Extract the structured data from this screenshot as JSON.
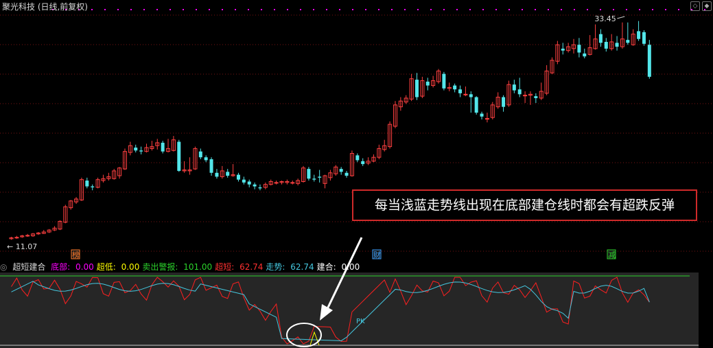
{
  "window": {
    "title": "聚光科技 (日线,前复权)"
  },
  "colors": {
    "up": "#ff4040",
    "down": "#53e6ea",
    "grid": "#7a1515",
    "magenta": "#ff00ff",
    "green_line": "#2bd22b",
    "red_line": "#ff2020",
    "cyan_line": "#45c8e0",
    "white": "#ffffff"
  },
  "price_chart": {
    "high_label": "33.45",
    "low_label": "11.07",
    "event_markers": [
      {
        "label": "榜",
        "color": "#ff7a2a"
      },
      {
        "label": "财",
        "color": "#3aa0ff"
      },
      {
        "label": "减",
        "color": "#2bd22b"
      }
    ]
  },
  "annotation": {
    "text": "每当浅蓝走势线出现在底部建仓线时都会有超跌反弹",
    "highlight_color": "#d02a2a"
  },
  "indicator": {
    "name": "超短建合",
    "items": [
      {
        "label": "底部:",
        "value": "0.00",
        "color": "#ff00ff"
      },
      {
        "label": "超低:",
        "value": "0.00",
        "color": "#ffff00"
      },
      {
        "label": "卖出警报:",
        "value": "101.00",
        "color": "#2bd22b"
      },
      {
        "label": "超短:",
        "value": "62.74",
        "color": "#ff3030"
      },
      {
        "label": "走势:",
        "value": "62.74",
        "color": "#45c8e0"
      },
      {
        "label": "建合:",
        "value": "0.00",
        "color": "#ffffff"
      }
    ],
    "pk_label": "PK"
  },
  "chart_data": {
    "type": "candlestick",
    "title": "聚光科技 (日线,前复权)",
    "ylim": [
      11.07,
      33.45
    ],
    "candles": [
      [
        11.0,
        11.1,
        10.9,
        11.2
      ],
      [
        11.1,
        11.15,
        11.0,
        11.3
      ],
      [
        11.2,
        11.3,
        11.1,
        11.4
      ],
      [
        11.3,
        11.35,
        11.2,
        11.5
      ],
      [
        11.3,
        11.5,
        11.2,
        11.6
      ],
      [
        11.5,
        11.6,
        11.4,
        11.7
      ],
      [
        11.55,
        11.7,
        11.5,
        11.9
      ],
      [
        11.7,
        11.9,
        11.6,
        12.0
      ],
      [
        11.9,
        12.1,
        11.8,
        12.3
      ],
      [
        12.0,
        12.8,
        11.9,
        12.9
      ],
      [
        12.7,
        14.3,
        12.6,
        14.5
      ],
      [
        14.2,
        14.9,
        14.0,
        15.0
      ],
      [
        14.8,
        15.1,
        14.6,
        15.3
      ],
      [
        15.0,
        17.1,
        14.9,
        17.3
      ],
      [
        17.0,
        16.4,
        16.2,
        17.3
      ],
      [
        16.4,
        16.3,
        16.0,
        16.6
      ],
      [
        16.3,
        17.1,
        16.2,
        17.3
      ],
      [
        17.0,
        17.2,
        16.8,
        17.6
      ],
      [
        17.2,
        17.4,
        17.0,
        17.8
      ],
      [
        17.2,
        18.0,
        17.1,
        18.2
      ],
      [
        17.5,
        18.3,
        17.2,
        18.4
      ],
      [
        18.2,
        20.0,
        18.1,
        20.3
      ],
      [
        19.9,
        20.6,
        19.6,
        21.0
      ],
      [
        20.4,
        20.1,
        19.9,
        20.7
      ],
      [
        20.1,
        20.0,
        19.7,
        20.5
      ],
      [
        20.0,
        20.4,
        19.9,
        20.8
      ],
      [
        20.3,
        20.5,
        20.1,
        21.1
      ],
      [
        20.6,
        20.9,
        20.2,
        21.3
      ],
      [
        20.9,
        20.0,
        19.8,
        21.1
      ],
      [
        20.0,
        20.3,
        19.9,
        21.3
      ],
      [
        20.1,
        21.2,
        20.0,
        21.6
      ],
      [
        21.0,
        18.0,
        17.9,
        21.2
      ],
      [
        18.0,
        18.1,
        17.8,
        19.0
      ],
      [
        18.0,
        18.1,
        17.6,
        19.4
      ],
      [
        18.2,
        20.3,
        18.1,
        20.5
      ],
      [
        20.0,
        19.4,
        19.2,
        20.3
      ],
      [
        19.4,
        19.1,
        18.9,
        19.6
      ],
      [
        19.2,
        17.8,
        17.5,
        19.4
      ],
      [
        17.8,
        17.4,
        17.2,
        18.2
      ],
      [
        17.4,
        18.0,
        17.2,
        18.5
      ],
      [
        17.9,
        17.5,
        17.3,
        18.2
      ],
      [
        17.5,
        17.6,
        17.4,
        18.7
      ],
      [
        17.6,
        17.1,
        16.9,
        17.8
      ],
      [
        17.1,
        16.8,
        16.6,
        17.4
      ],
      [
        16.9,
        16.6,
        16.3,
        17.1
      ],
      [
        16.6,
        16.4,
        16.1,
        16.8
      ],
      [
        16.3,
        16.2,
        16.0,
        16.6
      ],
      [
        16.3,
        16.6,
        16.1,
        16.8
      ],
      [
        16.6,
        16.9,
        16.5,
        17.1
      ],
      [
        16.8,
        16.8,
        16.6,
        17.0
      ],
      [
        16.8,
        16.9,
        16.6,
        17.0
      ],
      [
        16.8,
        16.9,
        16.6,
        17.1
      ],
      [
        16.8,
        16.8,
        16.6,
        17.0
      ],
      [
        16.7,
        17.0,
        16.5,
        17.2
      ],
      [
        16.9,
        18.3,
        16.8,
        18.5
      ],
      [
        18.2,
        17.2,
        17.0,
        18.4
      ],
      [
        17.2,
        17.1,
        16.9,
        17.6
      ],
      [
        17.4,
        17.3,
        16.8,
        18.1
      ],
      [
        16.7,
        17.5,
        16.2,
        17.6
      ],
      [
        17.3,
        17.8,
        17.0,
        18.1
      ],
      [
        17.7,
        18.4,
        17.5,
        18.6
      ],
      [
        18.2,
        17.9,
        17.6,
        18.4
      ],
      [
        17.8,
        17.5,
        17.3,
        18.0
      ],
      [
        17.5,
        19.8,
        17.4,
        20.1
      ],
      [
        19.6,
        19.1,
        18.9,
        19.8
      ],
      [
        19.0,
        18.7,
        18.5,
        19.3
      ],
      [
        18.8,
        19.0,
        18.6,
        19.4
      ],
      [
        19.0,
        19.4,
        18.9,
        19.7
      ],
      [
        19.4,
        20.3,
        19.2,
        20.7
      ],
      [
        20.2,
        20.6,
        20.0,
        21.2
      ],
      [
        20.5,
        22.8,
        20.3,
        23.1
      ],
      [
        22.6,
        24.8,
        22.4,
        25.2
      ],
      [
        24.6,
        25.2,
        24.2,
        25.6
      ],
      [
        25.1,
        25.5,
        24.9,
        25.8
      ],
      [
        25.4,
        27.5,
        25.2,
        28.0
      ],
      [
        27.4,
        25.6,
        25.3,
        28.1
      ],
      [
        25.7,
        27.3,
        25.5,
        27.7
      ],
      [
        27.2,
        26.8,
        26.3,
        27.6
      ],
      [
        26.8,
        27.3,
        26.6,
        27.8
      ],
      [
        27.2,
        28.3,
        27.0,
        28.5
      ],
      [
        28.0,
        26.5,
        26.3,
        28.2
      ],
      [
        26.5,
        26.6,
        26.2,
        27.1
      ],
      [
        26.8,
        26.4,
        26.1,
        27.0
      ],
      [
        26.4,
        26.0,
        25.6,
        26.8
      ],
      [
        25.9,
        25.9,
        25.7,
        26.7
      ],
      [
        25.9,
        25.6,
        24.0,
        26.2
      ],
      [
        25.6,
        24.0,
        23.8,
        25.7
      ],
      [
        23.9,
        23.6,
        23.3,
        24.1
      ],
      [
        23.4,
        23.4,
        23.0,
        24.0
      ],
      [
        23.5,
        24.8,
        23.3,
        25.1
      ],
      [
        24.6,
        25.6,
        24.4,
        26.1
      ],
      [
        25.6,
        24.6,
        24.1,
        25.8
      ],
      [
        24.8,
        26.9,
        24.6,
        27.3
      ],
      [
        26.9,
        26.3,
        26.0,
        27.4
      ],
      [
        26.4,
        25.9,
        25.6,
        27.6
      ],
      [
        25.8,
        25.8,
        25.0,
        26.2
      ],
      [
        25.8,
        25.9,
        24.8,
        26.2
      ],
      [
        25.7,
        25.5,
        25.0,
        26.0
      ],
      [
        25.5,
        26.2,
        25.3,
        27.1
      ],
      [
        26.0,
        28.3,
        25.8,
        28.9
      ],
      [
        28.1,
        29.4,
        28.0,
        29.7
      ],
      [
        29.3,
        31.0,
        29.0,
        31.4
      ],
      [
        30.6,
        30.4,
        30.0,
        31.2
      ],
      [
        30.4,
        30.8,
        30.2,
        31.2
      ],
      [
        30.6,
        31.0,
        30.1,
        31.6
      ],
      [
        31.0,
        30.2,
        29.7,
        31.7
      ],
      [
        30.1,
        29.8,
        29.6,
        30.6
      ],
      [
        30.0,
        30.7,
        29.9,
        32.0
      ],
      [
        30.6,
        31.6,
        30.5,
        33.1
      ],
      [
        32.1,
        31.2,
        30.8,
        32.6
      ],
      [
        31.3,
        30.6,
        30.3,
        31.7
      ],
      [
        30.6,
        31.3,
        30.4,
        32.1
      ],
      [
        31.2,
        30.8,
        30.4,
        31.9
      ],
      [
        30.8,
        31.6,
        30.6,
        33.3
      ],
      [
        31.5,
        31.2,
        31.0,
        33.3
      ],
      [
        31.0,
        32.1,
        30.9,
        32.6
      ],
      [
        32.4,
        31.6,
        31.4,
        33.45
      ],
      [
        32.3,
        31.1,
        30.9,
        32.5
      ],
      [
        31.0,
        27.7,
        27.5,
        31.5
      ]
    ],
    "indicator_series": {
      "sell_alert_green": [
        101,
        101,
        101,
        101,
        101,
        101,
        101,
        101,
        101,
        101,
        101,
        101,
        101,
        101,
        101,
        101,
        101,
        101,
        101,
        101
      ],
      "trend_cyan_last": 62.74,
      "short_red_last": 62.74
    }
  }
}
